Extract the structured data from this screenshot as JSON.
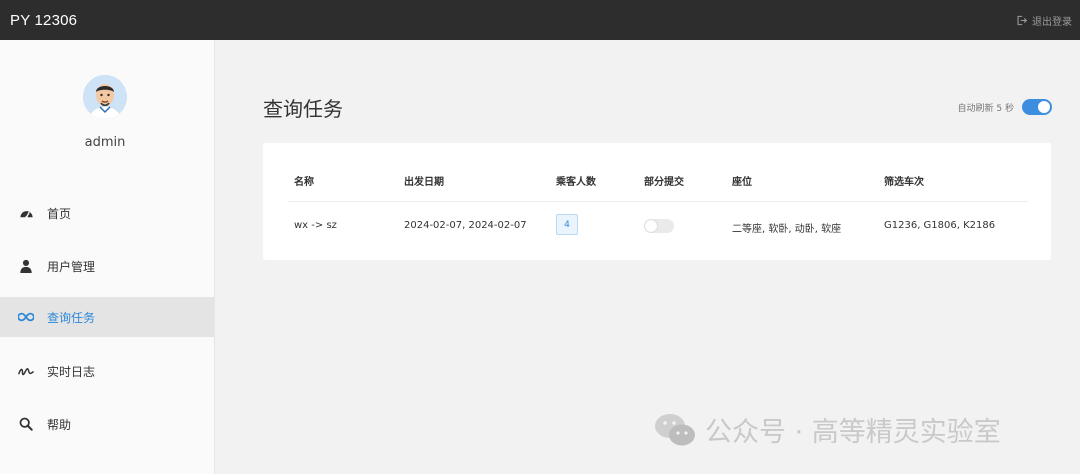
{
  "header": {
    "app_title": "PY 12306",
    "logout_label": "退出登录"
  },
  "sidebar": {
    "username": "admin",
    "items": [
      {
        "label": "首页",
        "icon": "dashboard-icon"
      },
      {
        "label": "用户管理",
        "icon": "user-icon"
      },
      {
        "label": "查询任务",
        "icon": "infinity-icon",
        "active": true
      },
      {
        "label": "实时日志",
        "icon": "signature-icon"
      },
      {
        "label": "帮助",
        "icon": "search-icon"
      }
    ]
  },
  "main": {
    "title": "查询任务",
    "auto_refresh_label": "自动刷新 5 秒",
    "auto_refresh_on": true,
    "table": {
      "headers": [
        "名称",
        "出发日期",
        "乘客人数",
        "部分提交",
        "座位",
        "筛选车次"
      ],
      "rows": [
        {
          "name": "wx -> sz",
          "dates": "2024-02-07, 2024-02-07",
          "passengers": "4",
          "partial_submit": false,
          "seats": "二等座, 软卧, 动卧, 软座",
          "trains": "G1236, G1806, K2186"
        }
      ]
    }
  },
  "watermark": {
    "text": "公众号 · 高等精灵实验室",
    "icon": "wechat-icon"
  },
  "colors": {
    "accent": "#2e88d8",
    "topbar": "#2d2d2d",
    "toggle": "#3e8ee0"
  }
}
